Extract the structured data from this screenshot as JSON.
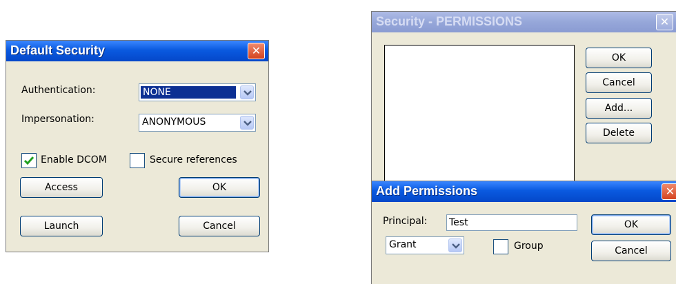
{
  "default_security": {
    "title": "Default Security",
    "close_glyph": "✕",
    "authentication_label": "Authentication:",
    "authentication_value": "NONE",
    "impersonation_label": "Impersonation:",
    "impersonation_value": "ANONYMOUS",
    "enable_dcom_label": "Enable DCOM",
    "enable_dcom_checked": true,
    "secure_references_label": "Secure references",
    "secure_references_checked": false,
    "access_label": "Access",
    "ok_label": "OK",
    "launch_label": "Launch",
    "cancel_label": "Cancel"
  },
  "security_permissions": {
    "title": "Security - PERMISSIONS",
    "close_glyph": "✕",
    "ok_label": "OK",
    "cancel_label": "Cancel",
    "add_label": "Add...",
    "delete_label": "Delete",
    "permissions_list": []
  },
  "add_permissions": {
    "title": "Add Permissions",
    "close_glyph": "✕",
    "principal_label": "Principal:",
    "principal_value": "Test",
    "access_type_value": "Grant",
    "group_label": "Group",
    "group_checked": false,
    "ok_label": "OK",
    "cancel_label": "Cancel"
  },
  "colors": {
    "title_active": "#0a5ae0",
    "title_inactive": "#96a7d9",
    "dialog_bg": "#ece9d8",
    "close_red": "#d4431f",
    "check_green": "#21a121",
    "selection": "#0c2f93"
  },
  "icons": {
    "close": "close-icon",
    "dropdown": "chevron-down-icon",
    "check": "checkmark-icon"
  }
}
